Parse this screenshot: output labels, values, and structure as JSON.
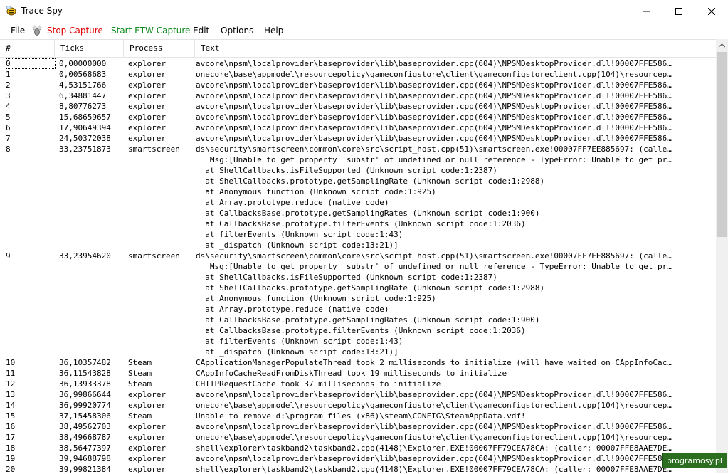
{
  "window": {
    "title": "Trace Spy",
    "controls": {
      "minimize": "–",
      "maximize": "☐",
      "close": "✕"
    }
  },
  "menu": {
    "file": "File",
    "stop_capture": "Stop Capture",
    "start_etw": "Start ETW Capture",
    "edit": "Edit",
    "options": "Options",
    "help": "Help"
  },
  "columns": [
    "#",
    "Ticks",
    "Process",
    "Text"
  ],
  "rows": [
    {
      "idx": "0",
      "ticks": "0,00000000",
      "proc": "explorer",
      "text": "avcore\\npsm\\localprovider\\baseprovider\\lib\\baseprovider.cpp(604)\\NPSMDesktopProvider.dll!00007FFE5861..."
    },
    {
      "idx": "1",
      "ticks": "0,00568683",
      "proc": "explorer",
      "text": "onecore\\base\\appmodel\\resourcepolicy\\gameconfigstore\\client\\gameconfigstoreclient.cpp(104)\\resourcepo..."
    },
    {
      "idx": "2",
      "ticks": "4,53151766",
      "proc": "explorer",
      "text": "avcore\\npsm\\localprovider\\baseprovider\\lib\\baseprovider.cpp(604)\\NPSMDesktopProvider.dll!00007FFE5861..."
    },
    {
      "idx": "3",
      "ticks": "6,34881447",
      "proc": "explorer",
      "text": "avcore\\npsm\\localprovider\\baseprovider\\lib\\baseprovider.cpp(604)\\NPSMDesktopProvider.dll!00007FFE5861..."
    },
    {
      "idx": "4",
      "ticks": "8,80776273",
      "proc": "explorer",
      "text": "avcore\\npsm\\localprovider\\baseprovider\\lib\\baseprovider.cpp(604)\\NPSMDesktopProvider.dll!00007FFE5861..."
    },
    {
      "idx": "5",
      "ticks": "15,68659657",
      "proc": "explorer",
      "text": "avcore\\npsm\\localprovider\\baseprovider\\lib\\baseprovider.cpp(604)\\NPSMDesktopProvider.dll!00007FFE5861..."
    },
    {
      "idx": "6",
      "ticks": "17,90649394",
      "proc": "explorer",
      "text": "avcore\\npsm\\localprovider\\baseprovider\\lib\\baseprovider.cpp(604)\\NPSMDesktopProvider.dll!00007FFE5861..."
    },
    {
      "idx": "7",
      "ticks": "24,50372038",
      "proc": "explorer",
      "text": "avcore\\npsm\\localprovider\\baseprovider\\lib\\baseprovider.cpp(604)\\NPSMDesktopProvider.dll!00007FFE5861..."
    },
    {
      "idx": "8",
      "ticks": "33,23751873",
      "proc": "smartscreen",
      "text": "ds\\security\\smartscreen\\common\\core\\src\\script_host.cpp(51)\\smartscreen.exe!00007FF7EE885697: (caller..."
    },
    {
      "idx": "",
      "ticks": "",
      "proc": "",
      "text": "   Msg:[Unable to get property 'substr' of undefined or null reference - TypeError: Unable to get pr..."
    },
    {
      "idx": "",
      "ticks": "",
      "proc": "",
      "text": "  at ShellCallbacks.isFileSupported (Unknown script code:1:2387)"
    },
    {
      "idx": "",
      "ticks": "",
      "proc": "",
      "text": "  at ShellCallbacks.prototype.getSamplingRate (Unknown script code:1:2988)"
    },
    {
      "idx": "",
      "ticks": "",
      "proc": "",
      "text": "  at Anonymous function (Unknown script code:1:925)"
    },
    {
      "idx": "",
      "ticks": "",
      "proc": "",
      "text": "  at Array.prototype.reduce (native code)"
    },
    {
      "idx": "",
      "ticks": "",
      "proc": "",
      "text": "  at CallbacksBase.prototype.getSamplingRates (Unknown script code:1:900)"
    },
    {
      "idx": "",
      "ticks": "",
      "proc": "",
      "text": "  at CallbacksBase.prototype.filterEvents (Unknown script code:1:2036)"
    },
    {
      "idx": "",
      "ticks": "",
      "proc": "",
      "text": "  at filterEvents (Unknown script code:1:43)"
    },
    {
      "idx": "",
      "ticks": "",
      "proc": "",
      "text": "  at _dispatch (Unknown script code:13:21)]"
    },
    {
      "idx": "9",
      "ticks": "33,23954620",
      "proc": "smartscreen",
      "text": "ds\\security\\smartscreen\\common\\core\\src\\script_host.cpp(51)\\smartscreen.exe!00007FF7EE885697: (caller..."
    },
    {
      "idx": "",
      "ticks": "",
      "proc": "",
      "text": "   Msg:[Unable to get property 'substr' of undefined or null reference - TypeError: Unable to get pr..."
    },
    {
      "idx": "",
      "ticks": "",
      "proc": "",
      "text": "  at ShellCallbacks.isFileSupported (Unknown script code:1:2387)"
    },
    {
      "idx": "",
      "ticks": "",
      "proc": "",
      "text": "  at ShellCallbacks.prototype.getSamplingRate (Unknown script code:1:2988)"
    },
    {
      "idx": "",
      "ticks": "",
      "proc": "",
      "text": "  at Anonymous function (Unknown script code:1:925)"
    },
    {
      "idx": "",
      "ticks": "",
      "proc": "",
      "text": "  at Array.prototype.reduce (native code)"
    },
    {
      "idx": "",
      "ticks": "",
      "proc": "",
      "text": "  at CallbacksBase.prototype.getSamplingRates (Unknown script code:1:900)"
    },
    {
      "idx": "",
      "ticks": "",
      "proc": "",
      "text": "  at CallbacksBase.prototype.filterEvents (Unknown script code:1:2036)"
    },
    {
      "idx": "",
      "ticks": "",
      "proc": "",
      "text": "  at filterEvents (Unknown script code:1:43)"
    },
    {
      "idx": "",
      "ticks": "",
      "proc": "",
      "text": "  at _dispatch (Unknown script code:13:21)]"
    },
    {
      "idx": "10",
      "ticks": "36,10357482",
      "proc": "Steam",
      "text": "CApplicationManagerPopulateThread took 2 milliseconds to initialize (will have waited on CAppInfoCach..."
    },
    {
      "idx": "11",
      "ticks": "36,11543828",
      "proc": "Steam",
      "text": "CAppInfoCacheReadFromDiskThread took 19 milliseconds to initialize"
    },
    {
      "idx": "12",
      "ticks": "36,13933378",
      "proc": "Steam",
      "text": "CHTTPRequestCache took 37 milliseconds to initialize"
    },
    {
      "idx": "13",
      "ticks": "36,99866644",
      "proc": "explorer",
      "text": "avcore\\npsm\\localprovider\\baseprovider\\lib\\baseprovider.cpp(604)\\NPSMDesktopProvider.dll!00007FFE5861..."
    },
    {
      "idx": "14",
      "ticks": "36,99920774",
      "proc": "explorer",
      "text": "onecore\\base\\appmodel\\resourcepolicy\\gameconfigstore\\client\\gameconfigstoreclient.cpp(104)\\resourcepo..."
    },
    {
      "idx": "15",
      "ticks": "37,15458306",
      "proc": "Steam",
      "text": "Unable to remove d:\\program files (x86)\\steam\\CONFIG\\SteamAppData.vdf!"
    },
    {
      "idx": "16",
      "ticks": "38,49562703",
      "proc": "explorer",
      "text": "avcore\\npsm\\localprovider\\baseprovider\\lib\\baseprovider.cpp(604)\\NPSMDesktopProvider.dll!00007FFE5861..."
    },
    {
      "idx": "17",
      "ticks": "38,49668787",
      "proc": "explorer",
      "text": "onecore\\base\\appmodel\\resourcepolicy\\gameconfigstore\\client\\gameconfigstoreclient.cpp(104)\\resourcepo..."
    },
    {
      "idx": "18",
      "ticks": "38,56477397",
      "proc": "explorer",
      "text": "shell\\explorer\\taskband2\\taskband2.cpp(4148)\\Explorer.EXE!00007FF79CEA78CA: (caller: 00007FFE8AAE7DE3..."
    },
    {
      "idx": "19",
      "ticks": "39,94688798",
      "proc": "explorer",
      "text": "avcore\\npsm\\localprovider\\baseprovider\\lib\\baseprovider.cpp(604)\\NPSMDesktopProvider.dll!00007FFE5861..."
    },
    {
      "idx": "20",
      "ticks": "39,99821384",
      "proc": "explorer",
      "text": "shell\\explorer\\taskband2\\taskband2.cpp(4148)\\Explorer.EXE!00007FF79CEA78CA: (caller: 00007FFE8AAE7DE3..."
    }
  ],
  "watermark": "programosy.pl",
  "colors": {
    "stop": "#e00000",
    "start": "#0a8a1a"
  }
}
